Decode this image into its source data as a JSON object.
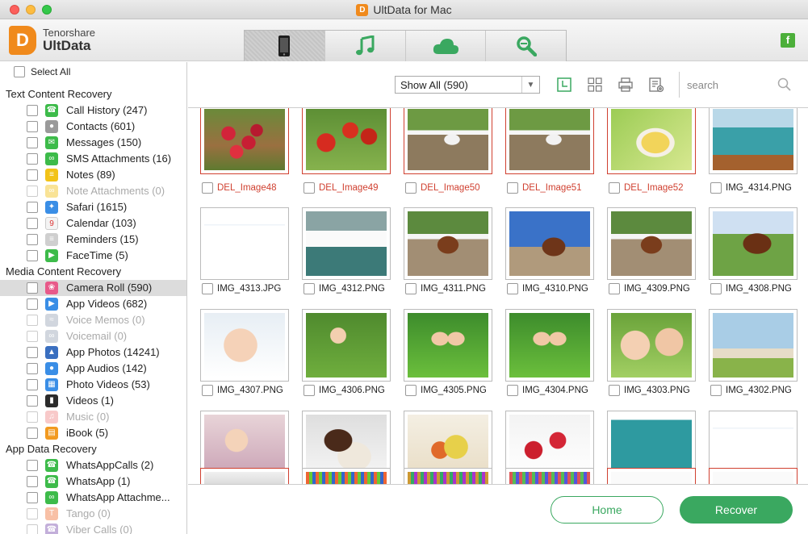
{
  "window": {
    "title": "UltData for Mac"
  },
  "brand": {
    "company": "Tenorshare",
    "product": "UltData"
  },
  "tabs": [
    {
      "name": "phone-icon",
      "active": true
    },
    {
      "name": "music-icon",
      "active": false
    },
    {
      "name": "cloud-icon",
      "active": false
    },
    {
      "name": "repair-icon",
      "active": false
    }
  ],
  "social": {
    "label": "f"
  },
  "sidebar": {
    "select_all": "Select All",
    "sections": [
      {
        "title": "Text Content Recovery",
        "items": [
          {
            "label": "Call History (247)",
            "icon": "phone-icon",
            "color": "#3dbb4a",
            "disabled": false
          },
          {
            "label": "Contacts (601)",
            "icon": "contacts-icon",
            "color": "#9a9a9a",
            "disabled": false
          },
          {
            "label": "Messages (150)",
            "icon": "message-icon",
            "color": "#3dbb4a",
            "disabled": false
          },
          {
            "label": "SMS Attachments (16)",
            "icon": "attachment-icon",
            "color": "#3dbb4a",
            "disabled": false
          },
          {
            "label": "Notes (89)",
            "icon": "notes-icon",
            "color": "#f2c318",
            "disabled": false
          },
          {
            "label": "Note Attachments (0)",
            "icon": "note-attachment-icon",
            "color": "#f2c318",
            "disabled": true
          },
          {
            "label": "Safari (1615)",
            "icon": "safari-icon",
            "color": "#3a8ee6",
            "disabled": false
          },
          {
            "label": "Calendar (103)",
            "icon": "calendar-icon",
            "color": "#e0e0e0",
            "disabled": false
          },
          {
            "label": "Reminders (15)",
            "icon": "reminders-icon",
            "color": "#cfcfcf",
            "disabled": false
          },
          {
            "label": "FaceTime (5)",
            "icon": "facetime-icon",
            "color": "#3dbb4a",
            "disabled": false
          }
        ]
      },
      {
        "title": "Media Content Recovery",
        "items": [
          {
            "label": "Camera Roll (590)",
            "icon": "photos-icon",
            "color": "#e85a8a",
            "disabled": false,
            "selected": true
          },
          {
            "label": "App Videos (682)",
            "icon": "app-video-icon",
            "color": "#3a8ee6",
            "disabled": false
          },
          {
            "label": "Voice Memos (0)",
            "icon": "voice-memo-icon",
            "color": "#9aa6b8",
            "disabled": true
          },
          {
            "label": "Voicemail (0)",
            "icon": "voicemail-icon",
            "color": "#9aa6b8",
            "disabled": true
          },
          {
            "label": "App Photos (14241)",
            "icon": "app-photo-icon",
            "color": "#3a6fc0",
            "disabled": false
          },
          {
            "label": "App Audios (142)",
            "icon": "microphone-icon",
            "color": "#3a8ee6",
            "disabled": false
          },
          {
            "label": "Photo Videos (53)",
            "icon": "photo-video-icon",
            "color": "#3a8ee6",
            "disabled": false
          },
          {
            "label": "Videos (1)",
            "icon": "clapper-icon",
            "color": "#2b2b2b",
            "disabled": false
          },
          {
            "label": "Music (0)",
            "icon": "music-note-icon",
            "color": "#f08a8a",
            "disabled": true
          },
          {
            "label": "iBook (5)",
            "icon": "ibook-icon",
            "color": "#f29a20",
            "disabled": false
          }
        ]
      },
      {
        "title": "App Data Recovery",
        "items": [
          {
            "label": "WhatsAppCalls (2)",
            "icon": "whatsapp-call-icon",
            "color": "#3dbb4a",
            "disabled": false
          },
          {
            "label": "WhatsApp (1)",
            "icon": "whatsapp-icon",
            "color": "#3dbb4a",
            "disabled": false
          },
          {
            "label": "WhatsApp Attachme...",
            "icon": "whatsapp-attachment-icon",
            "color": "#3dbb4a",
            "disabled": false
          },
          {
            "label": "Tango (0)",
            "icon": "tango-icon",
            "color": "#f0743c",
            "disabled": true
          },
          {
            "label": "Viber Calls (0)",
            "icon": "viber-icon",
            "color": "#7b4fae",
            "disabled": true
          }
        ]
      }
    ]
  },
  "toolbar": {
    "filter_value": "Show All (590)",
    "search_placeholder": "search",
    "icons": [
      "clock-view-icon",
      "grid-view-icon",
      "print-icon",
      "export-icon"
    ]
  },
  "grid": {
    "rows": [
      [
        {
          "name": "DEL_Image48",
          "deleted": true,
          "scene": "raspberries"
        },
        {
          "name": "DEL_Image49",
          "deleted": true,
          "scene": "apples"
        },
        {
          "name": "DEL_Image50",
          "deleted": true,
          "scene": "horse-white"
        },
        {
          "name": "DEL_Image51",
          "deleted": true,
          "scene": "horse-white"
        },
        {
          "name": "DEL_Image52",
          "deleted": true,
          "scene": "baby-food"
        },
        {
          "name": "IMG_4314.PNG",
          "deleted": false,
          "scene": "playpen"
        }
      ],
      [
        {
          "name": "IMG_4313.JPG",
          "deleted": false,
          "scene": "screenshot-white"
        },
        {
          "name": "IMG_4312.PNG",
          "deleted": false,
          "scene": "screenshot-phone"
        },
        {
          "name": "IMG_4311.PNG",
          "deleted": false,
          "scene": "horse-brown"
        },
        {
          "name": "IMG_4310.PNG",
          "deleted": false,
          "scene": "horse-brown-sky"
        },
        {
          "name": "IMG_4309.PNG",
          "deleted": false,
          "scene": "horse-brown"
        },
        {
          "name": "IMG_4308.PNG",
          "deleted": false,
          "scene": "horse-field"
        }
      ],
      [
        {
          "name": "IMG_4307.PNG",
          "deleted": false,
          "scene": "baby-face"
        },
        {
          "name": "IMG_4306.PNG",
          "deleted": false,
          "scene": "baby-walking"
        },
        {
          "name": "IMG_4305.PNG",
          "deleted": false,
          "scene": "feet-grass"
        },
        {
          "name": "IMG_4304.PNG",
          "deleted": false,
          "scene": "feet-grass"
        },
        {
          "name": "IMG_4303.PNG",
          "deleted": false,
          "scene": "kids-kiss"
        },
        {
          "name": "IMG_4302.PNG",
          "deleted": false,
          "scene": "nursery"
        }
      ],
      [
        {
          "name": "",
          "deleted": false,
          "scene": "toddler"
        },
        {
          "name": "",
          "deleted": false,
          "scene": "cookies"
        },
        {
          "name": "",
          "deleted": false,
          "scene": "food-plate"
        },
        {
          "name": "",
          "deleted": false,
          "scene": "strawberries"
        },
        {
          "name": "",
          "deleted": false,
          "scene": "screenshot-teal"
        },
        {
          "name": "",
          "deleted": false,
          "scene": "screenshot-white"
        }
      ]
    ]
  },
  "footer": {
    "home_label": "Home",
    "recover_label": "Recover"
  }
}
